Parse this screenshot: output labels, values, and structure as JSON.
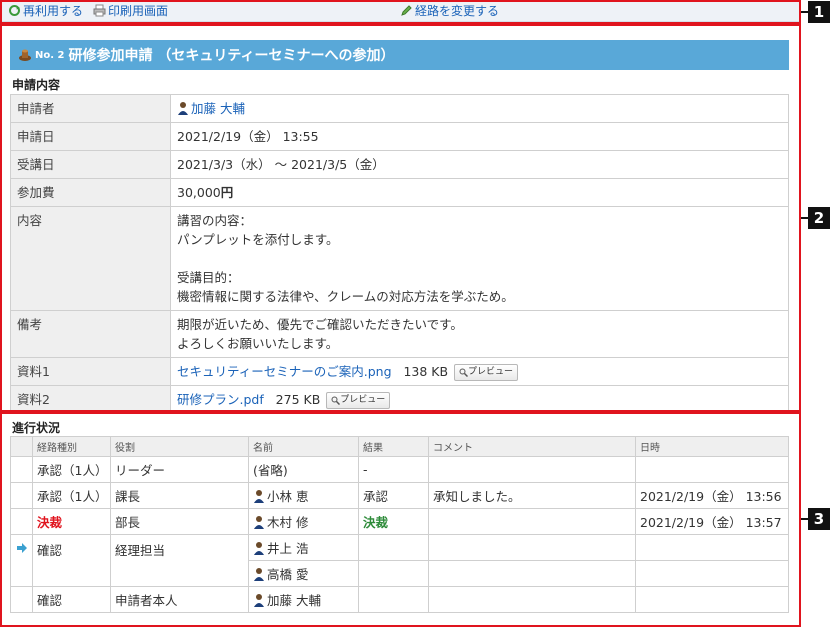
{
  "toolbar": {
    "reuse_label": "再利用する",
    "print_label": "印刷用画面",
    "change_route_label": "経路を変更する"
  },
  "request": {
    "number": "No. 2",
    "title": "研修参加申請 （セキュリティーセミナーへの参加）"
  },
  "details": {
    "section_label": "申請内容",
    "applicant_label": "申請者",
    "applicant": "加藤 大輔",
    "date_label": "申請日",
    "date": "2021/2/19（金） 13:55",
    "attend_label": "受講日",
    "attend": "2021/3/3（水） 〜 2021/3/5（金）",
    "fee_label": "参加費",
    "fee": "30,000",
    "fee_unit": "円",
    "content_label": "内容",
    "content": [
      "講習の内容：",
      "パンプレットを添付します。",
      "",
      "受講目的：",
      "機密情報に関する法律や、クレームの対応方法を学ぶため。"
    ],
    "remarks_label": "備考",
    "remarks": [
      "期限が近いため、優先でご確認いただきたいです。",
      "よろしくお願いいたします。"
    ],
    "file1_label": "資料1",
    "file1_name": "セキュリティーセミナーのご案内.png",
    "file1_size": "138 KB",
    "file2_label": "資料2",
    "file2_name": "研修プラン.pdf",
    "file2_size": "275 KB",
    "preview_label": "プレビュー"
  },
  "progress": {
    "section_label": "進行状況",
    "headers": [
      "経路種別",
      "役割",
      "名前",
      "結果",
      "コメント",
      "日時"
    ],
    "rows": [
      {
        "type": "承認（1人）",
        "role": "リーダー",
        "names": [
          "(省略)"
        ],
        "result": "-",
        "comment": "",
        "datetime": ""
      },
      {
        "type": "承認（1人）",
        "role": "課長",
        "names": [
          "小林 恵"
        ],
        "result": "承認",
        "comment": "承知しました。",
        "datetime": "2021/2/19（金） 13:56"
      },
      {
        "type": "決裁",
        "role": "部長",
        "names": [
          "木村 修"
        ],
        "result": "決裁",
        "comment": "",
        "datetime": "2021/2/19（金） 13:57"
      },
      {
        "type": "確認",
        "role": "経理担当",
        "names": [
          "井上 浩",
          "高橋 愛"
        ],
        "result": "",
        "comment": "",
        "datetime": ""
      },
      {
        "type": "確認",
        "role": "申請者本人",
        "names": [
          "加藤 大輔"
        ],
        "result": "",
        "comment": "",
        "datetime": ""
      }
    ]
  },
  "markers": [
    "1",
    "2",
    "3"
  ],
  "colors": {
    "annotation_red": "#e0141e",
    "title_bar": "#59a8d8",
    "link": "#1a62b8",
    "decision_result": "#2e8b3a"
  }
}
